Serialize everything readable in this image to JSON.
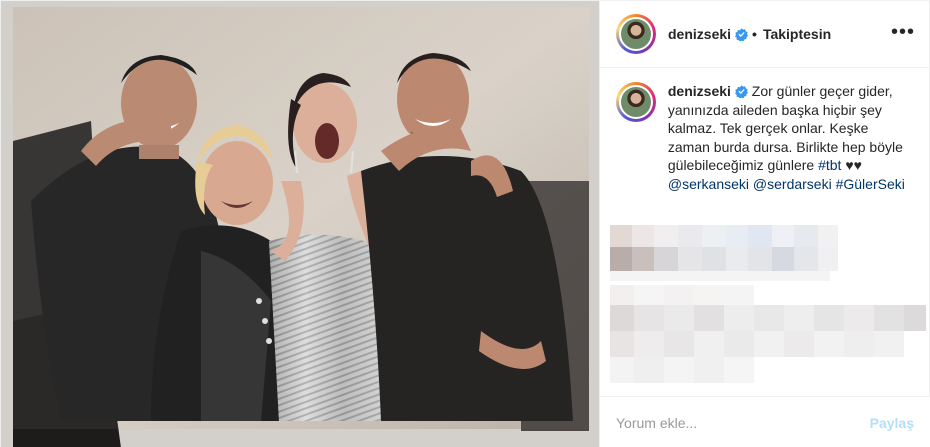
{
  "header": {
    "username": "denizseki",
    "separator": "•",
    "follow_status": "Takiptesin",
    "more_icon": "more-horizontal-icon"
  },
  "caption": {
    "username": "denizseki",
    "text": "Zor günler geçer gider, yanınızda aileden başka hiçbir şey kalmaz. Tek gerçek onlar. Keşke zaman burda dursa. Birlikte hep böyle gülebileceğimiz günlere",
    "hashtag_tbt": "#tbt",
    "hearts": "♥♥",
    "mention_1": "@serkanseki",
    "mention_2": "@serdarseki",
    "hashtag_2": "#GülerSeki"
  },
  "comment_box": {
    "placeholder": "Yorum ekle...",
    "share_label": "Paylaş"
  },
  "colors": {
    "verified": "#3897f0",
    "link": "#003569",
    "share_disabled": "#b2dffc",
    "border": "#efefef"
  }
}
